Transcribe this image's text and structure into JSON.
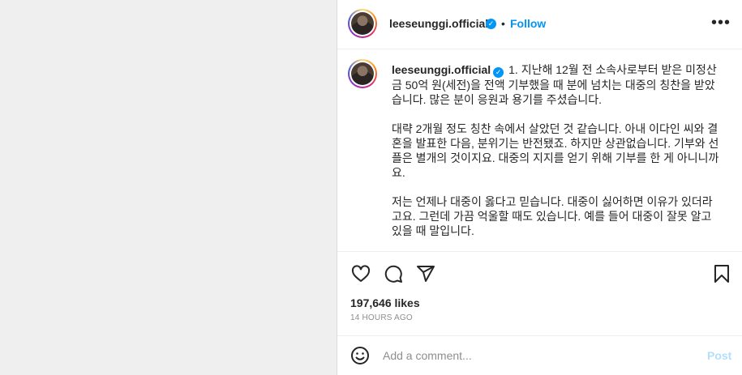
{
  "post": {
    "username": "leeseunggi.official",
    "verified_icon": "verified-badge-icon",
    "separator": "•",
    "follow_label": "Follow",
    "more_icon": "•••"
  },
  "caption": {
    "username": "leeseunggi.official",
    "text": "1. 지난해 12월 전 소속사로부터 받은 미정산금 50억 원(세전)을 전액 기부했을 때 분에 넘치는 대중의 칭찬을 받았습니다. 많은 분이 응원과 용기를 주셨습니다.\n\n대략 2개월 정도 칭찬 속에서 살았던 것 같습니다. 아내 이다인 씨와 결혼을 발표한 다음, 분위기는 반전됐죠. 하지만 상관없습니다. 기부와 선플은 별개의 것이지요. 대중의 지지를 얻기 위해 기부를 한 게 아니니까요.\n\n저는 언제나 대중이 옳다고 믿습니다. 대중이 싫어하면 이유가 있더라고요. 그런데 가끔 억울할 때도 있습니다. 예를 들어 대중이 잘못 알고 있을 때 말입니다."
  },
  "engagement": {
    "likes": "197,646 likes",
    "timestamp": "14 HOURS AGO"
  },
  "comment": {
    "placeholder": "Add a comment...",
    "post_label": "Post"
  },
  "colors": {
    "accent": "#0095f6",
    "post_disabled": "#b2dffc",
    "text": "#262626",
    "muted": "#8e8e8e"
  }
}
